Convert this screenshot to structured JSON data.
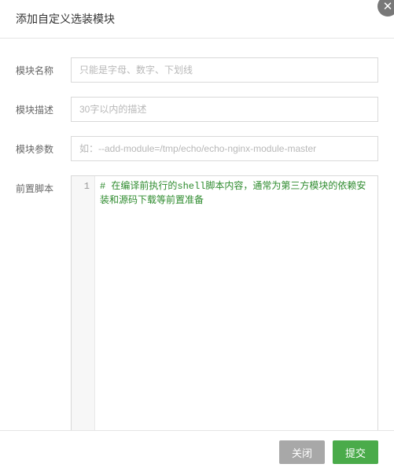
{
  "header": {
    "title": "添加自定义选装模块"
  },
  "form": {
    "name": {
      "label": "模块名称",
      "placeholder": "只能是字母、数字、下划线",
      "value": ""
    },
    "desc": {
      "label": "模块描述",
      "placeholder": "30字以内的描述",
      "value": ""
    },
    "params": {
      "label": "模块参数",
      "placeholder": "如：--add-module=/tmp/echo/echo-nginx-module-master",
      "value": ""
    },
    "script": {
      "label": "前置脚本",
      "line_number": "1",
      "content": "# 在编译前执行的shell脚本内容，通常为第三方模块的依赖安装和源码下载等前置准备"
    }
  },
  "footer": {
    "cancel": "关闭",
    "submit": "提交"
  }
}
